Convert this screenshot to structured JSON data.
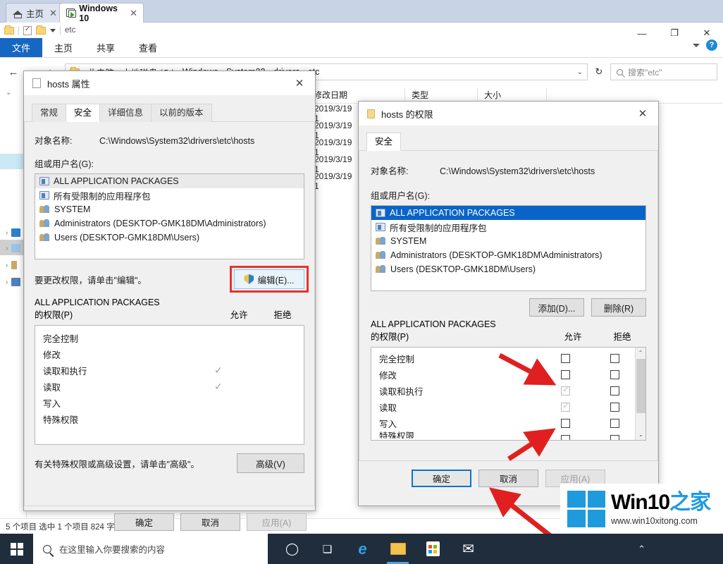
{
  "explorer": {
    "tabs": [
      {
        "label": "主页",
        "icon": "home-icon",
        "active": false,
        "close": "✕"
      },
      {
        "label": "Windows 10",
        "icon": "window-app-icon",
        "active": true,
        "close": "✕"
      }
    ],
    "quick_access": {
      "path_label": "etc"
    },
    "window_controls": {
      "minimize": "—",
      "maximize": "❐",
      "close": "✕"
    },
    "ribbon_tabs": [
      "文件",
      "主页",
      "共享",
      "查看"
    ],
    "ribbon_help": "?",
    "address": {
      "back": "←",
      "forward": "→",
      "up": "↑",
      "crumbs": [
        "此电脑",
        "本地磁盘 (C:)",
        "Windows",
        "System32",
        "drivers",
        "etc"
      ],
      "separator": "›",
      "dropdown": "⌄",
      "refresh": "↻"
    },
    "search": {
      "placeholder": "搜索\"etc\"",
      "icon": "search-icon"
    },
    "columns": [
      "修改日期",
      "类型",
      "大小"
    ],
    "files": [
      {
        "date": "2019/3/19 1"
      },
      {
        "date": "2019/3/19 1"
      },
      {
        "date": "2019/3/19 1"
      },
      {
        "date": "2019/3/19 1"
      },
      {
        "date": "2019/3/19 1"
      }
    ],
    "status": "5 个项目    选中 1 个项目  824 字节"
  },
  "dialog_properties": {
    "title": "hosts 属性",
    "icon": "file-icon",
    "close": "✕",
    "tabs": [
      "常规",
      "安全",
      "详细信息",
      "以前的版本"
    ],
    "active_tab": "安全",
    "object_name_label": "对象名称:",
    "object_name_value": "C:\\Windows\\System32\\drivers\\etc\\hosts",
    "group_label": "组或用户名(G):",
    "groups": [
      {
        "name": "ALL APPLICATION PACKAGES",
        "icon": "package-icon",
        "highlight": "gray"
      },
      {
        "name": "所有受限制的应用程序包",
        "icon": "package-icon",
        "highlight": "none"
      },
      {
        "name": "SYSTEM",
        "icon": "user-icon",
        "highlight": "none"
      },
      {
        "name": "Administrators (DESKTOP-GMK18DM\\Administrators)",
        "icon": "user-icon",
        "highlight": "none"
      },
      {
        "name": "Users (DESKTOP-GMK18DM\\Users)",
        "icon": "user-icon",
        "highlight": "none"
      }
    ],
    "edit_hint": "要更改权限，请单击\"编辑\"。",
    "edit_button": "编辑(E)...",
    "perm_subject": "ALL APPLICATION PACKAGES",
    "perm_label": "的权限(P)",
    "col_allow": "允许",
    "col_deny": "拒绝",
    "permissions": [
      {
        "name": "完全控制",
        "allow": "none",
        "deny": "none"
      },
      {
        "name": "修改",
        "allow": "none",
        "deny": "none"
      },
      {
        "name": "读取和执行",
        "allow": "check",
        "deny": "none"
      },
      {
        "name": "读取",
        "allow": "check",
        "deny": "none"
      },
      {
        "name": "写入",
        "allow": "none",
        "deny": "none"
      },
      {
        "name": "特殊权限",
        "allow": "none",
        "deny": "none"
      }
    ],
    "advanced_hint": "有关特殊权限或高级设置，请单击\"高级\"。",
    "advanced_button": "高级(V)",
    "footer": {
      "ok": "确定",
      "cancel": "取消",
      "apply": "应用(A)"
    }
  },
  "dialog_permissions": {
    "title": "hosts 的权限",
    "icon": "folder-icon",
    "close": "✕",
    "tabs": [
      "安全"
    ],
    "active_tab": "安全",
    "object_name_label": "对象名称:",
    "object_name_value": "C:\\Windows\\System32\\drivers\\etc\\hosts",
    "group_label": "组或用户名(G):",
    "groups": [
      {
        "name": "ALL APPLICATION PACKAGES",
        "icon": "package-icon",
        "highlight": "blue"
      },
      {
        "name": "所有受限制的应用程序包",
        "icon": "package-icon",
        "highlight": "none"
      },
      {
        "name": "SYSTEM",
        "icon": "user-icon",
        "highlight": "none"
      },
      {
        "name": "Administrators (DESKTOP-GMK18DM\\Administrators)",
        "icon": "user-icon",
        "highlight": "none"
      },
      {
        "name": "Users (DESKTOP-GMK18DM\\Users)",
        "icon": "user-icon",
        "highlight": "none"
      }
    ],
    "add_button": "添加(D)...",
    "remove_button": "删除(R)",
    "perm_subject": "ALL APPLICATION PACKAGES",
    "perm_label": "的权限(P)",
    "col_allow": "允许",
    "col_deny": "拒绝",
    "permissions": [
      {
        "name": "完全控制",
        "allow": "empty",
        "deny": "empty"
      },
      {
        "name": "修改",
        "allow": "empty",
        "deny": "empty"
      },
      {
        "name": "读取和执行",
        "allow": "checked-disabled",
        "deny": "empty"
      },
      {
        "name": "读取",
        "allow": "checked-disabled",
        "deny": "empty"
      },
      {
        "name": "写入",
        "allow": "empty",
        "deny": "empty"
      },
      {
        "name": "特殊权限",
        "allow": "empty",
        "deny": "empty"
      }
    ],
    "scroll": {
      "up": "⌃",
      "down": "⌄"
    },
    "footer": {
      "ok": "确定",
      "cancel": "取消",
      "apply": "应用(A)"
    }
  },
  "taskbar": {
    "start_icon": "windows-logo-icon",
    "search_placeholder": "在这里输入你要搜索的内容",
    "icons": [
      {
        "name": "cortana-icon",
        "glyph": "◯"
      },
      {
        "name": "task-view-icon",
        "glyph": "❏"
      },
      {
        "name": "edge-icon",
        "glyph": "e"
      },
      {
        "name": "file-explorer-icon",
        "glyph": "📁"
      },
      {
        "name": "microsoft-store-icon",
        "glyph": "🛍"
      },
      {
        "name": "mail-icon",
        "glyph": "✉"
      }
    ],
    "tray_chevron": "⌃"
  },
  "watermark": {
    "brand_main": "Win10",
    "brand_suffix": "之家",
    "url": "www.win10xitong.com",
    "logo": "windows-logo-icon",
    "accent_color": "#1f9bdd"
  },
  "annotations": {
    "edit_button_highlight_color": "#e8322e",
    "arrow_color": "#e02020",
    "ok_focus_color": "#0b74c8"
  }
}
